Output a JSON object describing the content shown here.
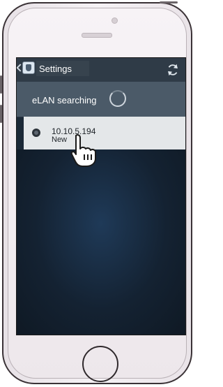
{
  "header": {
    "title": "Settings",
    "back_icon": "chevron-left-icon",
    "app_icon": "app-logo-icon",
    "refresh_icon": "refresh-icon"
  },
  "search": {
    "label": "eLAN searching"
  },
  "devices": [
    {
      "ip": "10.10.5.194",
      "status": "New"
    }
  ],
  "colors": {
    "header_bg": "#2f3b47",
    "search_bg": "#4b5a68",
    "row_bg": "#e4e7e9",
    "screen_bg": "#1b2937"
  }
}
